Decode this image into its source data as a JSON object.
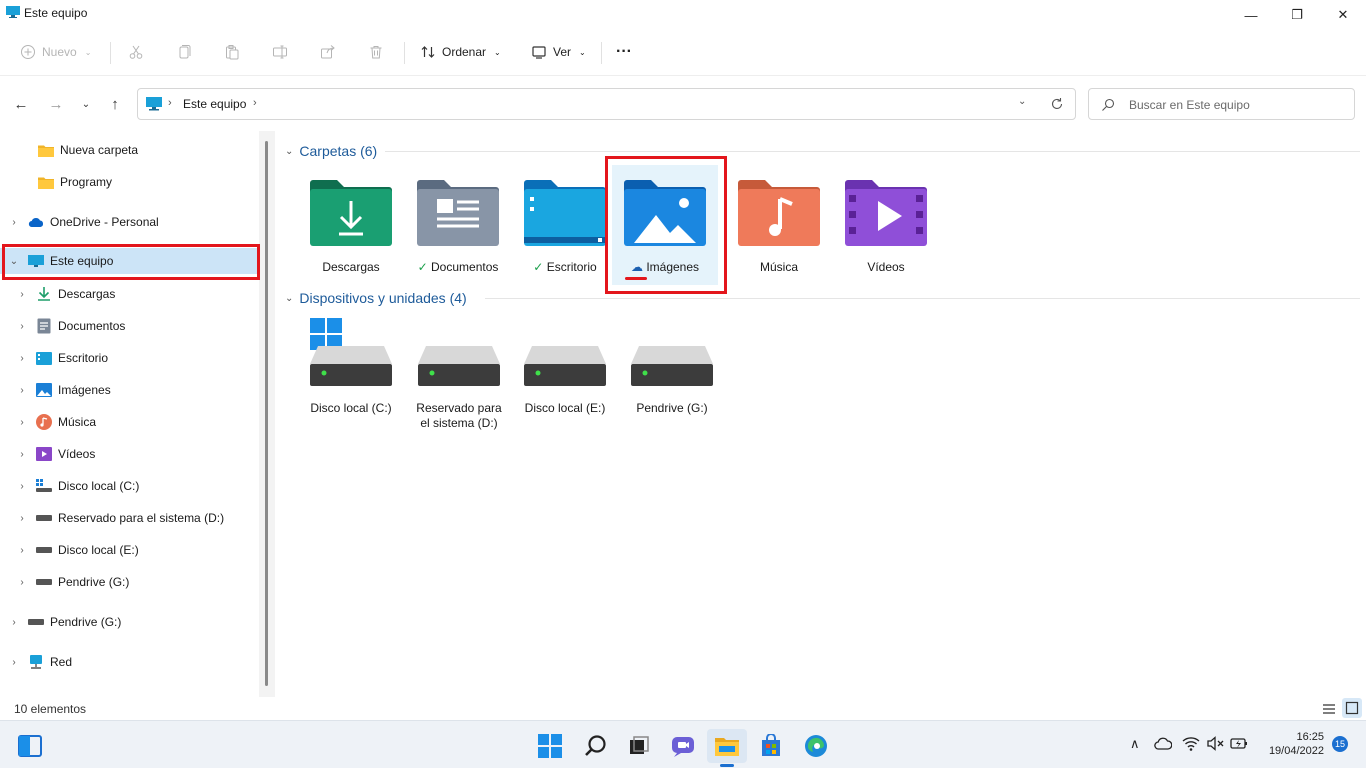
{
  "window": {
    "title": "Este equipo",
    "minimize_label": "—",
    "maximize_label": "❐",
    "close_label": "✕"
  },
  "commandbar": {
    "new_label": "Nuevo",
    "sort_label": "Ordenar",
    "view_label": "Ver",
    "more_label": "···"
  },
  "address": {
    "crumb": "Este equipo",
    "search_placeholder": "Buscar en Este equipo"
  },
  "nav": {
    "items": [
      {
        "label": "Nueva carpeta",
        "icon": "folder-icon"
      },
      {
        "label": "Programy",
        "icon": "folder-icon"
      },
      {
        "label": "OneDrive - Personal",
        "icon": "onedrive-icon"
      },
      {
        "label": "Este equipo",
        "icon": "pc-icon"
      },
      {
        "label": "Descargas",
        "icon": "download-icon"
      },
      {
        "label": "Documentos",
        "icon": "document-icon"
      },
      {
        "label": "Escritorio",
        "icon": "desktop-icon"
      },
      {
        "label": "Imágenes",
        "icon": "pictures-icon"
      },
      {
        "label": "Música",
        "icon": "music-icon"
      },
      {
        "label": "Vídeos",
        "icon": "videos-icon"
      },
      {
        "label": "Disco local (C:)",
        "icon": "windows-drive-icon"
      },
      {
        "label": "Reservado para el sistema (D:)",
        "icon": "drive-icon"
      },
      {
        "label": "Disco local (E:)",
        "icon": "drive-icon"
      },
      {
        "label": "Pendrive (G:)",
        "icon": "drive-icon"
      },
      {
        "label": "Pendrive (G:)",
        "icon": "drive-icon"
      },
      {
        "label": "Red",
        "icon": "network-icon"
      }
    ]
  },
  "content": {
    "folders_header": "Carpetas (6)",
    "devices_header": "Dispositivos y unidades (4)",
    "folders": [
      {
        "label": "Descargas",
        "status": ""
      },
      {
        "label": "Documentos",
        "status": "synced"
      },
      {
        "label": "Escritorio",
        "status": "synced"
      },
      {
        "label": "Imágenes",
        "status": "cloud"
      },
      {
        "label": "Música",
        "status": ""
      },
      {
        "label": "Vídeos",
        "status": ""
      }
    ],
    "drives": [
      {
        "label": "Disco local (C:)"
      },
      {
        "label": "Reservado para el sistema (D:)"
      },
      {
        "label": "Disco local (E:)"
      },
      {
        "label": "Pendrive (G:)"
      }
    ]
  },
  "status": {
    "count": "10 elementos"
  },
  "taskbar": {
    "time": "16:25",
    "date": "19/04/2022",
    "notifications": "15"
  },
  "colors": {
    "accent": "#0067c0",
    "highlight_red": "#e3161c",
    "selected_bg": "#cce4f7"
  }
}
